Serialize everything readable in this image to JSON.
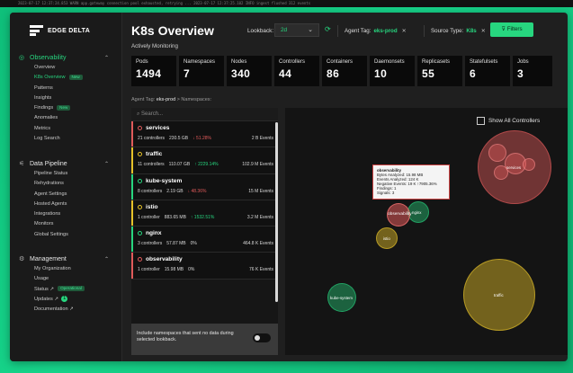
{
  "top_strip": "2023-07-17 12:37:24.853  WARN  app.gateway  connection pool exhausted, retrying ...  2023-07-17 12:37:25.102  INFO  ingest  flushed 312 events",
  "logo": {
    "text": "EDGE DELTA"
  },
  "sidebar": {
    "sections": [
      {
        "label": "Observability",
        "icon": "eye-icon",
        "active": true,
        "items": [
          {
            "label": "Overview"
          },
          {
            "label": "K8s Overview",
            "badge": "New",
            "active": true
          },
          {
            "label": "Patterns"
          },
          {
            "label": "Insights"
          },
          {
            "label": "Findings",
            "badge": "New"
          },
          {
            "label": "Anomalies"
          },
          {
            "label": "Metrics"
          },
          {
            "label": "Log Search"
          }
        ]
      },
      {
        "label": "Data Pipeline",
        "icon": "pipeline-icon",
        "items": [
          {
            "label": "Pipeline Status"
          },
          {
            "label": "Rehydrations"
          },
          {
            "label": "Agent Settings"
          },
          {
            "label": "Hosted Agents"
          },
          {
            "label": "Integrations"
          },
          {
            "label": "Monitors"
          },
          {
            "label": "Global Settings"
          }
        ]
      },
      {
        "label": "Management",
        "icon": "gear-icon",
        "items": [
          {
            "label": "My Organization"
          },
          {
            "label": "Usage"
          },
          {
            "label": "Status ↗",
            "badge": "Operational"
          },
          {
            "label": "Updates ↗",
            "dot": "1"
          },
          {
            "label": "Documentation ↗"
          }
        ]
      }
    ]
  },
  "header": {
    "title": "K8s Overview",
    "subtitle": "Actively Monitoring",
    "lookback_label": "Lookback:",
    "lookback_value": "2d",
    "agent_tag_label": "Agent Tag:",
    "agent_tag_value": "eks-prod",
    "source_type_label": "Source Type:",
    "source_type_value": "K8s",
    "filters_label": "Filters"
  },
  "metrics": [
    {
      "label": "Pods",
      "value": "1494"
    },
    {
      "label": "Namespaces",
      "value": "7"
    },
    {
      "label": "Nodes",
      "value": "340"
    },
    {
      "label": "Controllers",
      "value": "44"
    },
    {
      "label": "Containers",
      "value": "86"
    },
    {
      "label": "Daemonsets",
      "value": "10"
    },
    {
      "label": "Replicasets",
      "value": "55"
    },
    {
      "label": "Statefulsets",
      "value": "6"
    },
    {
      "label": "Jobs",
      "value": "3"
    }
  ],
  "breadcrumb": {
    "prefix": "Agent Tag:",
    "tag": "eks-prod",
    "rest": "> Namespaces:"
  },
  "namespaces": {
    "search_placeholder": "Search...",
    "rows": [
      {
        "name": "services",
        "color": "#e05a5a",
        "controllers": "21 controllers",
        "bytes": "230.5 GB",
        "change": "↓ 51.28%",
        "dir": "down",
        "events": "2 B Events"
      },
      {
        "name": "traffic",
        "color": "#e6c229",
        "controllers": "11 controllers",
        "bytes": "110.07 GB",
        "change": "↑ 2229.14%",
        "dir": "up",
        "events": "102.9 M Events"
      },
      {
        "name": "kube-system",
        "color": "#27d67f",
        "controllers": "8 controllers",
        "bytes": "2.19 GB",
        "change": "↓ 48.36%",
        "dir": "down",
        "events": "15 M Events"
      },
      {
        "name": "istio",
        "color": "#e6c229",
        "controllers": "1 controller",
        "bytes": "883.65 MB",
        "change": "↑ 1532.51%",
        "dir": "up",
        "events": "3.2 M Events"
      },
      {
        "name": "nginx",
        "color": "#27d67f",
        "controllers": "3 controllers",
        "bytes": "57.87 MB",
        "change": "0%",
        "dir": "flat",
        "events": "464.8 K Events"
      },
      {
        "name": "observability",
        "color": "#e05a5a",
        "controllers": "1 controller",
        "bytes": "15.98 MB",
        "change": "0%",
        "dir": "flat",
        "events": "76 K Events"
      }
    ],
    "include_text": "Include namespaces that sent no data during selected lookback."
  },
  "graph": {
    "show_all_label": "Show All Controllers",
    "bubbles": [
      {
        "name": "services",
        "color": "#e05a5a"
      },
      {
        "name": "traffic",
        "color": "#e6c229"
      },
      {
        "name": "kube-system",
        "color": "#27d67f"
      },
      {
        "name": "istio",
        "color": "#e6c229"
      },
      {
        "name": "nginx",
        "color": "#27d67f"
      },
      {
        "name": "observability",
        "color": "#e05a5a"
      }
    ],
    "tooltip": {
      "title": "observability",
      "lines": [
        "Bytes Analyzed: 15.98 MB",
        "Events Analyzed: 124 K",
        "Negative Events: 19 K ↑7905.36%",
        "Findings: 1",
        "Signals: 3"
      ]
    }
  }
}
